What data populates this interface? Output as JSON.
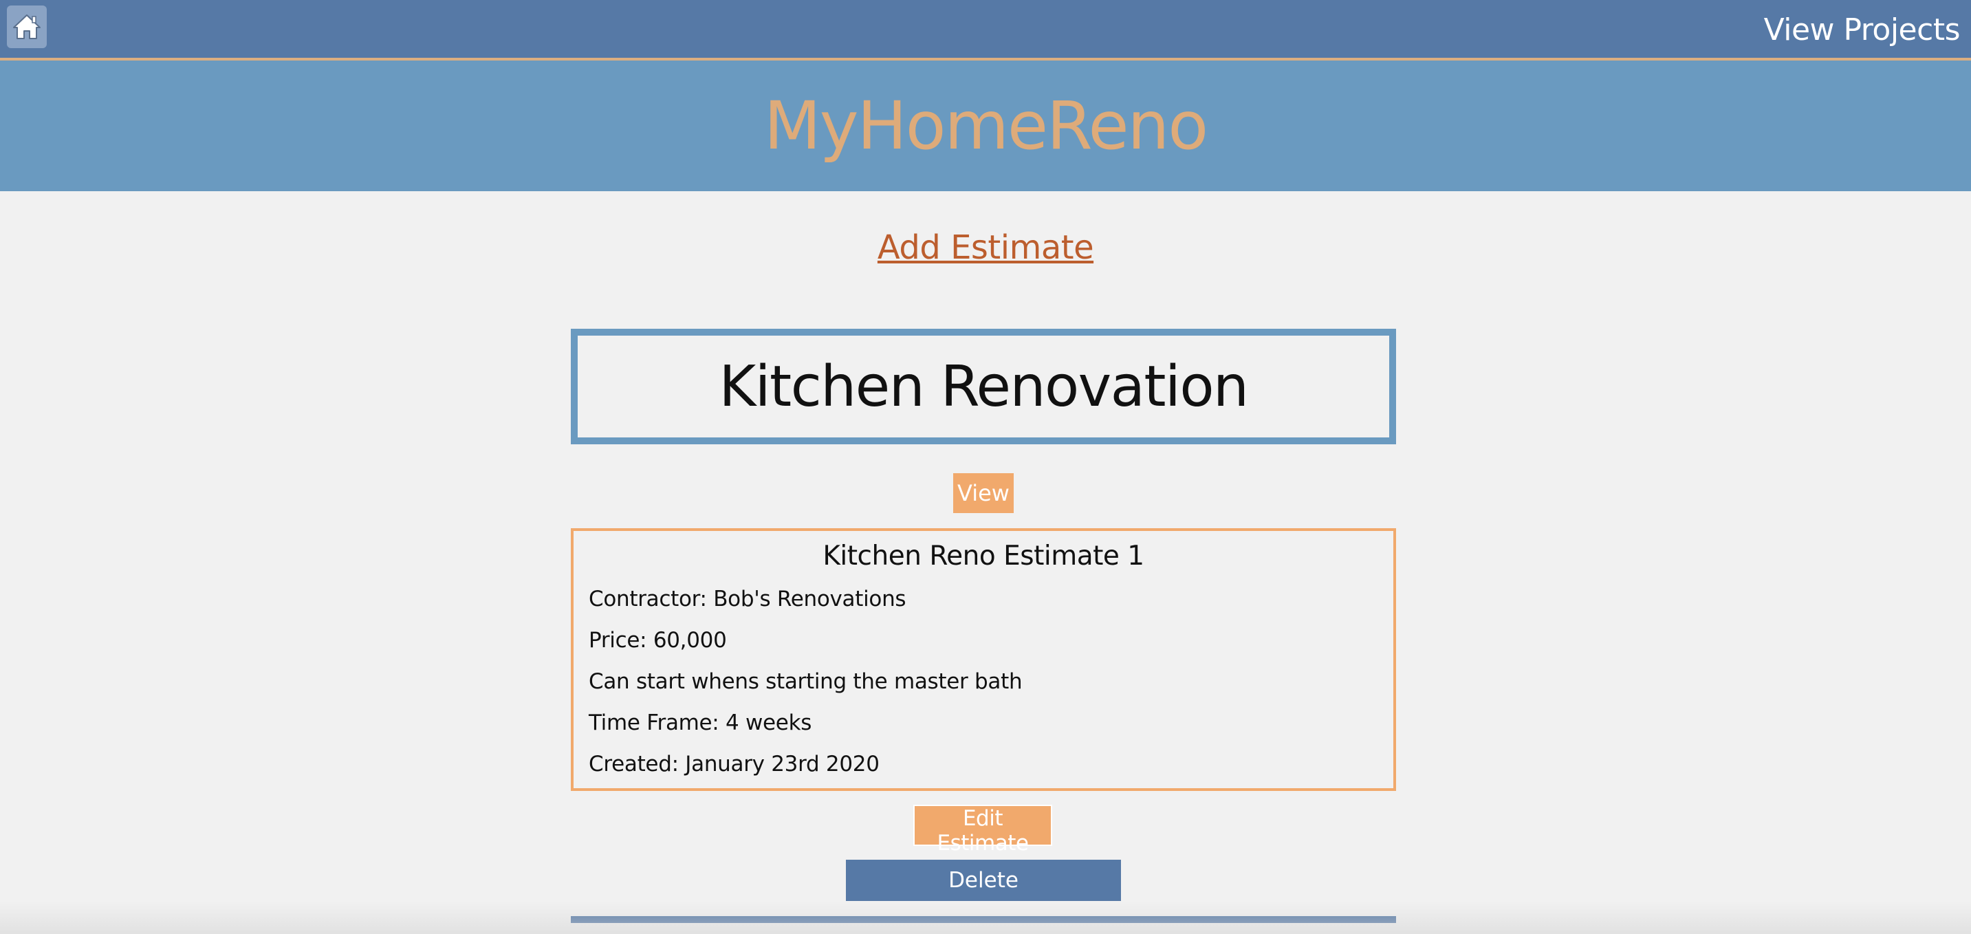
{
  "nav": {
    "home_icon": "home-icon",
    "view_projects_label": "View Projects"
  },
  "brand": {
    "title": "MyHomeReno"
  },
  "actions": {
    "add_estimate_label": "Add Estimate"
  },
  "project": {
    "title": "Kitchen Renovation",
    "view_label": "View"
  },
  "estimate": {
    "title": "Kitchen Reno Estimate 1",
    "contractor": "Contractor: Bob's Renovations",
    "price": "Price: 60,000",
    "note": "Can start whens starting the master bath",
    "time_frame": "Time Frame: 4 weeks",
    "created": "Created: January 23rd 2020",
    "edit_label": "Edit Estimate",
    "delete_label": "Delete"
  },
  "colors": {
    "nav_bar": "#5679a6",
    "brand_band": "#6a9ac0",
    "brand_text": "#deab7a",
    "accent_orange": "#f1a96c",
    "link": "#bc5e2e",
    "background": "#f1f1f1"
  }
}
